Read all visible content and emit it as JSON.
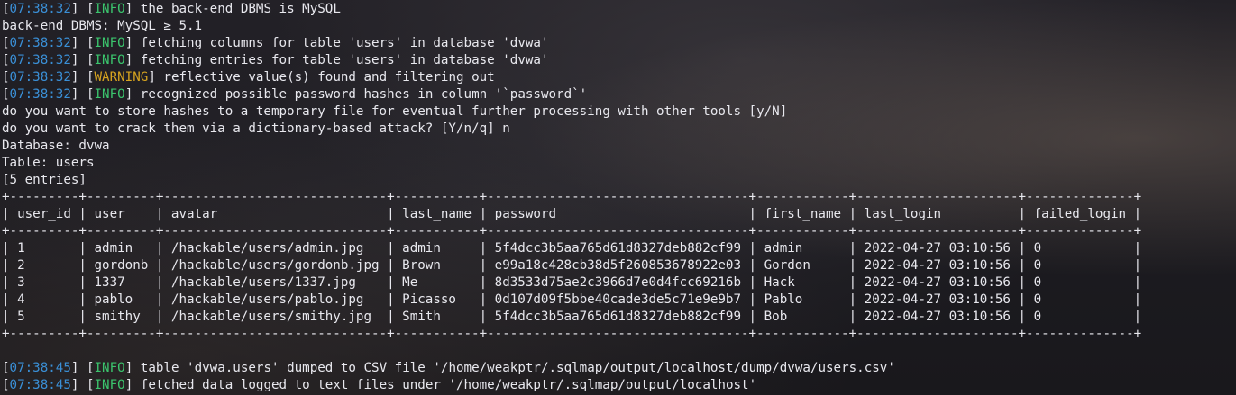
{
  "log_top": [
    {
      "time": "07:38:32",
      "level": "INFO",
      "level_type": "info",
      "msg": "the back-end DBMS is MySQL"
    },
    {
      "plain": "back-end DBMS: MySQL ≥ 5.1"
    },
    {
      "time": "07:38:32",
      "level": "INFO",
      "level_type": "info",
      "msg": "fetching columns for table 'users' in database 'dvwa'"
    },
    {
      "time": "07:38:32",
      "level": "INFO",
      "level_type": "info",
      "msg": "fetching entries for table 'users' in database 'dvwa'"
    },
    {
      "time": "07:38:32",
      "level": "WARNING",
      "level_type": "warn",
      "msg": "reflective value(s) found and filtering out"
    },
    {
      "time": "07:38:32",
      "level": "INFO",
      "level_type": "info",
      "msg": "recognized possible password hashes in column '`password`'"
    },
    {
      "plain": "do you want to store hashes to a temporary file for eventual further processing with other tools [y/N]"
    },
    {
      "plain": "do you want to crack them via a dictionary-based attack? [Y/n/q] n"
    },
    {
      "plain": "Database: dvwa"
    },
    {
      "plain": "Table: users"
    },
    {
      "plain": "[5 entries]"
    }
  ],
  "table": {
    "border": "+---------+---------+-----------------------------+-----------+----------------------------------+------------+---------------------+--------------+",
    "header": "| user_id | user    | avatar                      | last_name | password                         | first_name | last_login          | failed_login |",
    "rows": [
      "| 1       | admin   | /hackable/users/admin.jpg   | admin     | 5f4dcc3b5aa765d61d8327deb882cf99 | admin      | 2022-04-27 03:10:56 | 0            |",
      "| 2       | gordonb | /hackable/users/gordonb.jpg | Brown     | e99a18c428cb38d5f260853678922e03 | Gordon     | 2022-04-27 03:10:56 | 0            |",
      "| 3       | 1337    | /hackable/users/1337.jpg    | Me        | 8d3533d75ae2c3966d7e0d4fcc69216b | Hack       | 2022-04-27 03:10:56 | 0            |",
      "| 4       | pablo   | /hackable/users/pablo.jpg   | Picasso   | 0d107d09f5bbe40cade3de5c71e9e9b7 | Pablo      | 2022-04-27 03:10:56 | 0            |",
      "| 5       | smithy  | /hackable/users/smithy.jpg  | Smith     | 5f4dcc3b5aa765d61d8327deb882cf99 | Bob        | 2022-04-27 03:10:56 | 0            |"
    ]
  },
  "log_bottom": [
    {
      "time": "07:38:45",
      "level": "INFO",
      "level_type": "info",
      "msg": "table 'dvwa.users' dumped to CSV file '/home/weakptr/.sqlmap/output/localhost/dump/dvwa/users.csv'"
    },
    {
      "time": "07:38:45",
      "level": "INFO",
      "level_type": "info",
      "msg": "fetched data logged to text files under '/home/weakptr/.sqlmap/output/localhost'"
    }
  ],
  "colors": {
    "timestamp": "#3a8fd6",
    "info": "#3bc46d",
    "warning": "#d6a31f",
    "text": "#e8e8ee"
  }
}
